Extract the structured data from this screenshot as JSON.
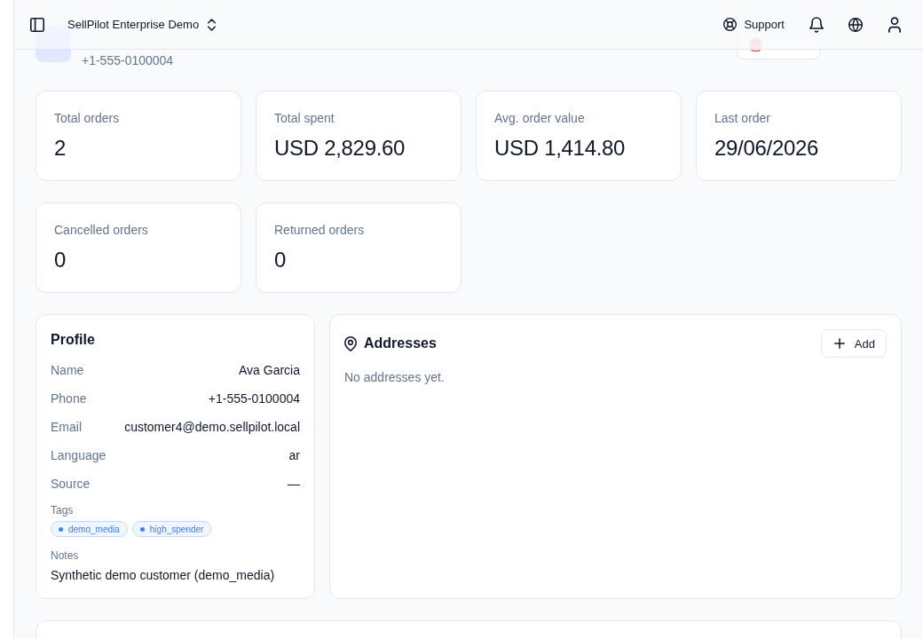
{
  "topbar": {
    "workspace": "SellPilot Enterprise Demo",
    "support_label": "Support"
  },
  "customer": {
    "phone": "+1-555-0100004"
  },
  "stats": [
    {
      "label": "Total orders",
      "value": "2"
    },
    {
      "label": "Total spent",
      "value": "USD 2,829.60"
    },
    {
      "label": "Avg. order value",
      "value": "USD 1,414.80"
    },
    {
      "label": "Last order",
      "value": "29/06/2026"
    },
    {
      "label": "Cancelled orders",
      "value": "0"
    },
    {
      "label": "Returned orders",
      "value": "0"
    }
  ],
  "profile": {
    "title": "Profile",
    "fields": [
      {
        "label": "Name",
        "value": "Ava Garcia"
      },
      {
        "label": "Phone",
        "value": "+1-555-0100004"
      },
      {
        "label": "Email",
        "value": "customer4@demo.sellpilot.local"
      },
      {
        "label": "Language",
        "value": "ar"
      },
      {
        "label": "Source",
        "value": "—"
      }
    ],
    "tags_label": "Tags",
    "tags": [
      "demo_media",
      "high_spender"
    ],
    "notes_label": "Notes",
    "notes": "Synthetic demo customer (demo_media)"
  },
  "addresses": {
    "title": "Addresses",
    "add_button": "Add",
    "empty_message": "No addresses yet."
  }
}
